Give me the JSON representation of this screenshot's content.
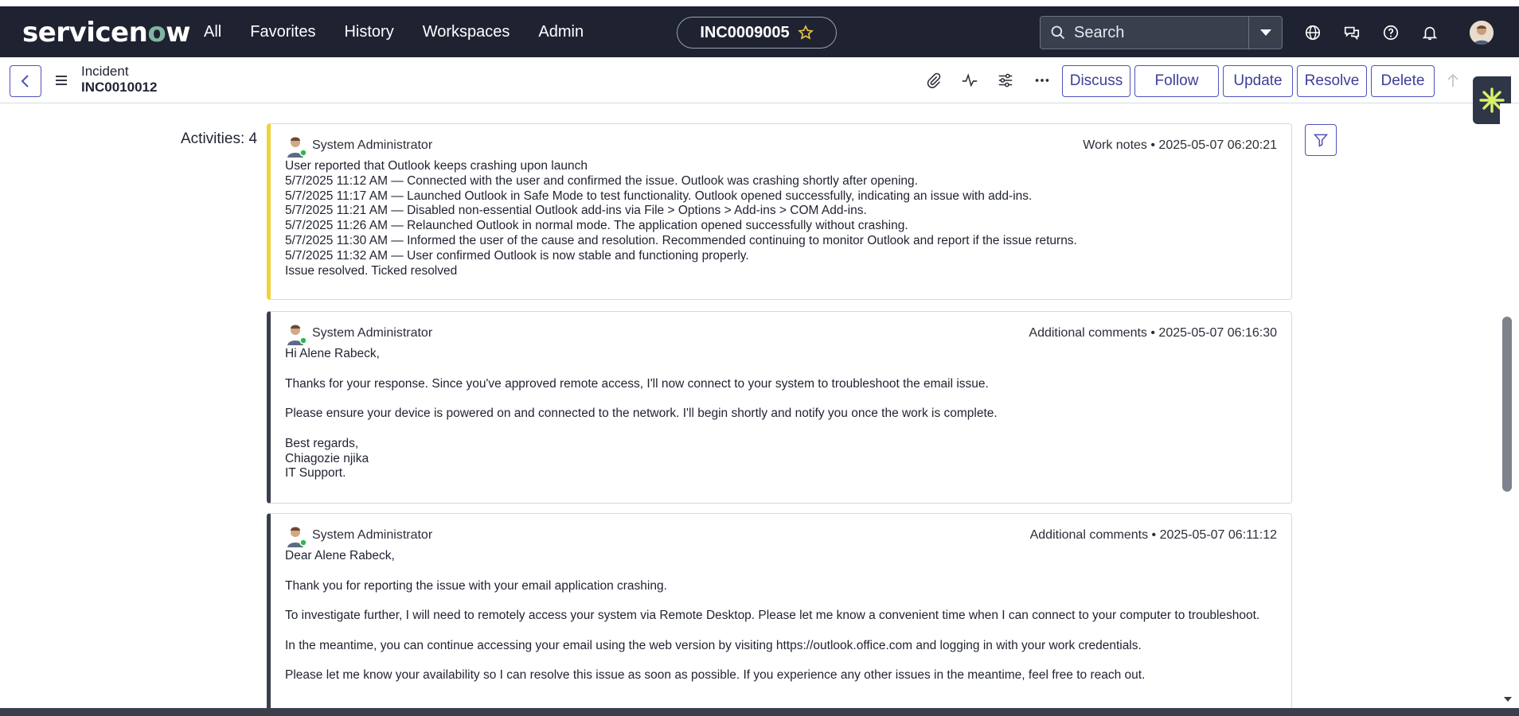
{
  "brand": {
    "logo_text_a": "servicen",
    "logo_text_o": "o",
    "logo_text_b": "w"
  },
  "nav": {
    "items": [
      "All",
      "Favorites",
      "History",
      "Workspaces",
      "Admin"
    ]
  },
  "current_record_pill": "INC0009005",
  "search": {
    "placeholder": "Search"
  },
  "header": {
    "record_type": "Incident",
    "record_number": "INC0010012",
    "buttons": {
      "discuss": "Discuss",
      "follow": "Follow",
      "update": "Update",
      "resolve": "Resolve",
      "delete": "Delete"
    }
  },
  "activities": {
    "label": "Activities: 4",
    "entries": [
      {
        "author": "System Administrator",
        "type": "Work notes",
        "timestamp": "2025-05-07 06:20:21",
        "lines": [
          "User reported that Outlook keeps crashing upon launch",
          "5/7/2025 11:12 AM — Connected with the user and confirmed the issue. Outlook was crashing shortly after opening.",
          "5/7/2025 11:17 AM — Launched Outlook in Safe Mode to test functionality. Outlook opened successfully, indicating an issue with add-ins.",
          "5/7/2025 11:21 AM — Disabled non-essential Outlook add-ins via File > Options > Add-ins > COM Add-ins.",
          "5/7/2025 11:26 AM — Relaunched Outlook in normal mode. The application opened successfully without crashing.",
          "5/7/2025 11:30 AM — Informed the user of the cause and resolution. Recommended continuing to monitor Outlook and report if the issue returns.",
          "5/7/2025 11:32 AM — User confirmed Outlook is now stable and functioning properly.",
          "Issue resolved. Ticked resolved"
        ]
      },
      {
        "author": "System Administrator",
        "type": "Additional comments",
        "timestamp": "2025-05-07 06:16:30",
        "greeting": "Hi Alene Rabeck,",
        "p1": "Thanks for your response. Since you've approved remote access, I'll now connect to your system to troubleshoot the email issue.",
        "p2": "Please ensure your device is powered on and connected to the network. I'll begin shortly and notify you once the work is complete.",
        "sign1": "Best regards,",
        "sign2": "Chiagozie njika",
        "sign3": "IT Support."
      },
      {
        "author": "System Administrator",
        "type": "Additional comments",
        "timestamp": "2025-05-07 06:11:12",
        "greeting": "Dear Alene Rabeck,",
        "p1": "Thank you for reporting the issue with your email application crashing.",
        "p2": "To investigate further, I will need to remotely access your system via Remote Desktop. Please let me know a convenient time when I can connect to your computer to troubleshoot.",
        "p3": "In the meantime, you can continue accessing your email using the web version by visiting https://outlook.office.com and logging in with your work credentials.",
        "p4": "Please let me know your availability so I can resolve this issue as soon as possible. If you experience any other issues in the meantime, feel free to reach out."
      }
    ]
  },
  "colors": {
    "navbar": "#1f2331",
    "accent": "#4f52bd",
    "worknote_bar": "#f0d33c",
    "comment_bar": "#3b3f4c"
  },
  "icons": [
    "search-icon",
    "chevron-down-icon",
    "globe-icon",
    "chat-icon",
    "help-icon",
    "bell-icon",
    "star-icon",
    "back-arrow-icon",
    "hamburger-icon",
    "paperclip-icon",
    "activity-icon",
    "sliders-icon",
    "more-icon",
    "up-arrow-icon",
    "filter-icon",
    "now-assist-icon"
  ]
}
